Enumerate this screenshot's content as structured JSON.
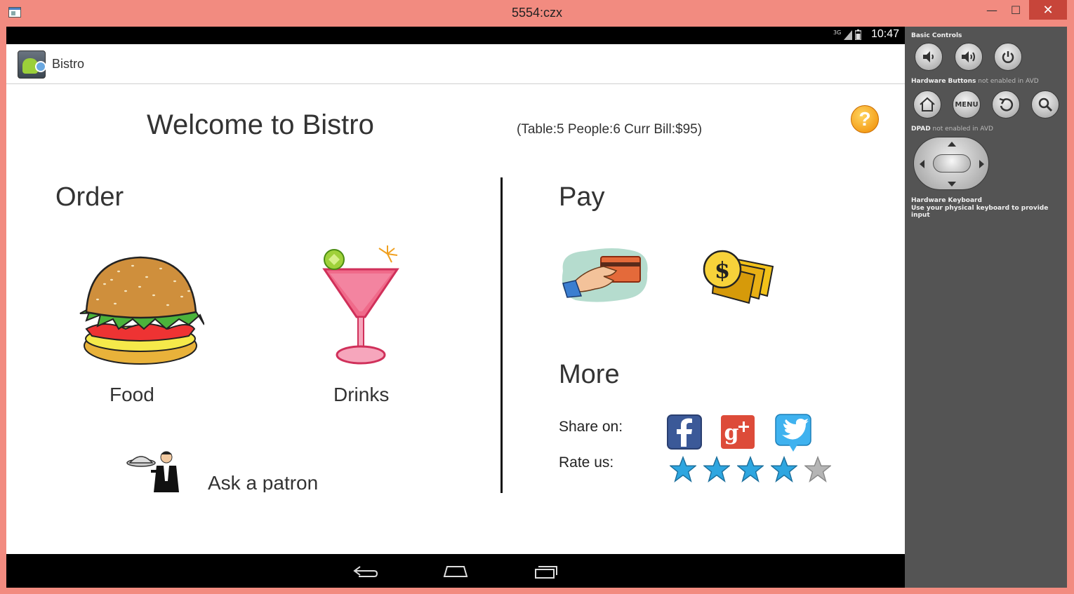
{
  "window": {
    "title": "5554:czx",
    "minimize_glyph": "—",
    "maximize_glyph": "☐",
    "close_glyph": "✕"
  },
  "statusbar": {
    "time": "10:47",
    "signal": "3G"
  },
  "actionbar": {
    "title": "Bistro"
  },
  "main": {
    "welcome": "Welcome to Bistro",
    "table_info": "(Table:5 People:6 Curr Bill:$95)",
    "help_glyph": "?"
  },
  "order": {
    "heading": "Order",
    "food_label": "Food",
    "drinks_label": "Drinks",
    "ask_patron_label": "Ask a patron"
  },
  "pay": {
    "heading": "Pay"
  },
  "more": {
    "heading": "More",
    "share_label": "Share on:",
    "rate_label": "Rate us:",
    "rating": 4,
    "rating_max": 5
  },
  "avd": {
    "basic_controls": "Basic Controls",
    "hw_buttons": "Hardware Buttons",
    "hw_buttons_note": " not enabled in AVD",
    "dpad": "DPAD",
    "dpad_note": " not enabled in AVD",
    "hw_keyboard": "Hardware Keyboard",
    "hw_keyboard_note": "Use your physical keyboard to provide input",
    "menu_label": "MENU"
  },
  "colors": {
    "frame": "#f28b80",
    "star_filled": "#2ea6e0",
    "star_empty": "#b5b5b5",
    "help": "#f59a0c",
    "facebook": "#3b5998",
    "googleplus": "#dd4b39",
    "twitter": "#3fb2ef"
  }
}
